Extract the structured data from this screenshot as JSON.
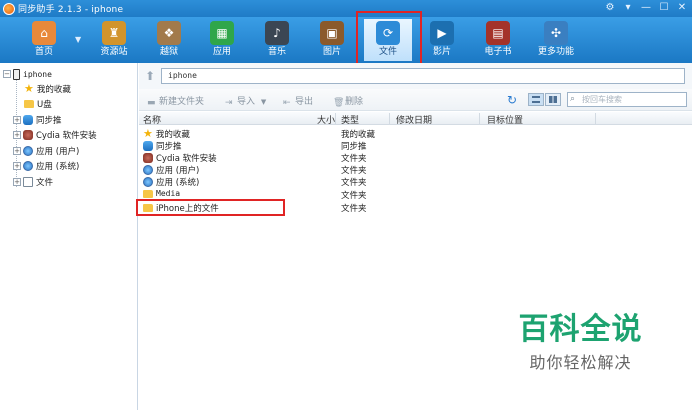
{
  "window": {
    "title": "同步助手 2.1.3 - iphone",
    "controls": [
      "⚙",
      "▾",
      "—",
      "☐",
      "✕"
    ]
  },
  "toolbar": {
    "items": [
      {
        "label": "首页",
        "icon": "home-icon",
        "color": "#e8893a"
      },
      {
        "label": "资源站",
        "icon": "store-icon",
        "color": "#d2942c"
      },
      {
        "label": "越狱",
        "icon": "jailbreak-icon",
        "color": "#a27a4b"
      },
      {
        "label": "应用",
        "icon": "apps-icon",
        "color": "#2fa64a"
      },
      {
        "label": "音乐",
        "icon": "music-icon",
        "color": "#3b4653"
      },
      {
        "label": "图片",
        "icon": "photo-icon",
        "color": "#8b5a2b"
      },
      {
        "label": "文件",
        "icon": "files-icon",
        "color": "#2d8bd7"
      },
      {
        "label": "影片",
        "icon": "video-icon",
        "color": "#1c6fb0"
      },
      {
        "label": "电子书",
        "icon": "ebook-icon",
        "color": "#a4332a"
      },
      {
        "label": "更多功能",
        "icon": "more-icon",
        "color": "#3a7fc1"
      }
    ],
    "active_index": 6
  },
  "sidebar": {
    "device": "iphone",
    "items": [
      {
        "label": "我的收藏",
        "icon": "star-icon"
      },
      {
        "label": "U盘",
        "icon": "folder-icon"
      },
      {
        "label": "同步推",
        "icon": "tongbutui-icon"
      },
      {
        "label": "Cydia 软件安装",
        "icon": "cydia-icon"
      },
      {
        "label": "应用 (用户)",
        "icon": "app-user-icon"
      },
      {
        "label": "应用 (系统)",
        "icon": "app-system-icon"
      },
      {
        "label": "文件",
        "icon": "file-icon"
      }
    ]
  },
  "pathbar": {
    "path": "iphone"
  },
  "actions": {
    "new_folder": "新建文件夹",
    "import": "导入",
    "export": "导出",
    "delete": "删除",
    "search_placeholder": "按回车搜索"
  },
  "columns": {
    "name": "名称",
    "size": "大小",
    "type": "类型",
    "modified": "修改日期",
    "target": "目标位置"
  },
  "files": [
    {
      "name": "我的收藏",
      "type": "我的收藏",
      "icon": "star-icon"
    },
    {
      "name": "同步推",
      "type": "同步推",
      "icon": "tongbutui-icon"
    },
    {
      "name": "Cydia 软件安装",
      "type": "文件夹",
      "icon": "cydia-icon"
    },
    {
      "name": "应用 (用户)",
      "type": "文件夹",
      "icon": "app-user-icon"
    },
    {
      "name": "应用 (系统)",
      "type": "文件夹",
      "icon": "app-system-icon"
    },
    {
      "name": "Media",
      "type": "文件夹",
      "icon": "folder-icon"
    },
    {
      "name": "iPhone上的文件",
      "type": "文件夹",
      "icon": "folder-icon"
    }
  ],
  "watermark": {
    "main": "百科全说",
    "sub": "助你轻松解决"
  }
}
